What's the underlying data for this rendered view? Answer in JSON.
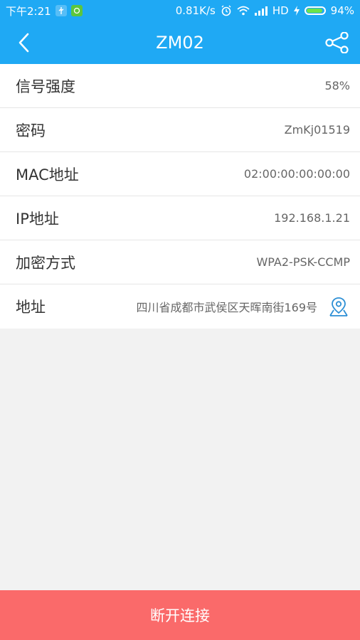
{
  "status_bar": {
    "time": "下午2:21",
    "speed": "0.81K/s",
    "network": "HD",
    "battery": "94%",
    "battery_level": 0.94
  },
  "nav": {
    "title": "ZM02"
  },
  "rows": [
    {
      "label": "信号强度",
      "value": "58%"
    },
    {
      "label": "密码",
      "value": "ZmKj01519"
    },
    {
      "label": "MAC地址",
      "value": "02:00:00:00:00:00"
    },
    {
      "label": "IP地址",
      "value": "192.168.1.21"
    },
    {
      "label": "加密方式",
      "value": "WPA2-PSK-CCMP"
    },
    {
      "label": "地址",
      "value": "四川省成都市武侯区天晖南街169号"
    }
  ],
  "actions": {
    "disconnect_label": "断开连接"
  },
  "colors": {
    "header": "#1fa9f4",
    "disconnect": "#fa6a6a",
    "icon_blue": "#2d8fd5"
  },
  "icons": {
    "back": "chevron-left-icon",
    "share": "share-icon",
    "location": "location-pin-icon"
  }
}
